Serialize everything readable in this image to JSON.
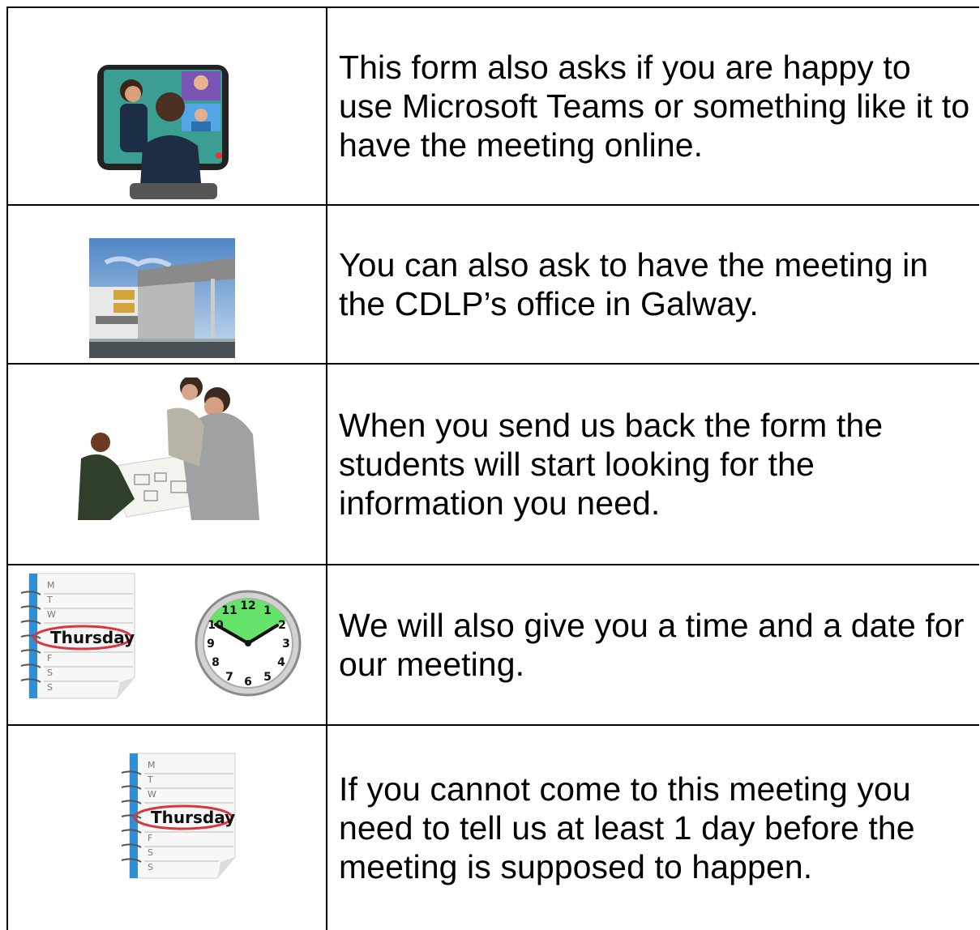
{
  "rows": [
    {
      "text": "This form also asks if you are happy to use Microsoft Teams or something like it to have the meeting online.",
      "image": "video-call-picture"
    },
    {
      "text": "You can also ask to have the meeting in the CDLP’s office in Galway.",
      "image": "office-building-picture"
    },
    {
      "text": "When you send us back the form the students will start looking for the information you need.",
      "image": "students-looking-at-plans-picture"
    },
    {
      "text": "We will also give you a time and a date for our meeting.",
      "image": "calendar-and-clock-picture"
    },
    {
      "text": "If you cannot come to this meeting you need to tell us at least 1 day before the meeting is supposed to happen.",
      "image": "calendar-picture"
    }
  ],
  "calendar": {
    "days": [
      "M",
      "T",
      "W",
      "Thursday",
      "F",
      "S",
      "S"
    ]
  },
  "clock": {
    "numbers": [
      "12",
      "1",
      "2",
      "3",
      "4",
      "5",
      "6",
      "7",
      "8",
      "9",
      "10",
      "11"
    ]
  },
  "colors": {
    "border": "#000000",
    "calendar_spine": "#2f8fd6",
    "calendar_circle": "#d9363e",
    "clock_face": "#66e36b",
    "clock_rim": "#bfbfbf"
  }
}
